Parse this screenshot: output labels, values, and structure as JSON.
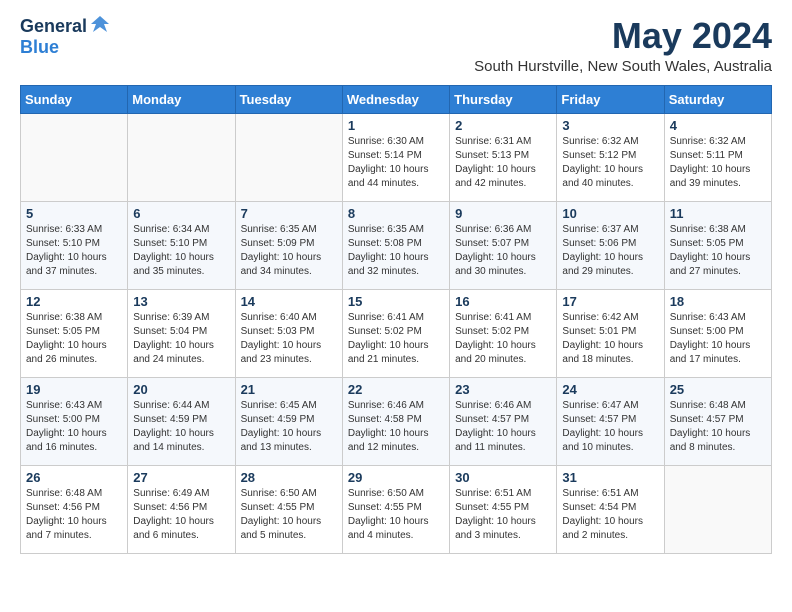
{
  "header": {
    "logo_general": "General",
    "logo_blue": "Blue",
    "title": "May 2024",
    "subtitle": "South Hurstville, New South Wales, Australia"
  },
  "weekdays": [
    "Sunday",
    "Monday",
    "Tuesday",
    "Wednesday",
    "Thursday",
    "Friday",
    "Saturday"
  ],
  "weeks": [
    [
      {
        "day": "",
        "info": ""
      },
      {
        "day": "",
        "info": ""
      },
      {
        "day": "",
        "info": ""
      },
      {
        "day": "1",
        "info": "Sunrise: 6:30 AM\nSunset: 5:14 PM\nDaylight: 10 hours\nand 44 minutes."
      },
      {
        "day": "2",
        "info": "Sunrise: 6:31 AM\nSunset: 5:13 PM\nDaylight: 10 hours\nand 42 minutes."
      },
      {
        "day": "3",
        "info": "Sunrise: 6:32 AM\nSunset: 5:12 PM\nDaylight: 10 hours\nand 40 minutes."
      },
      {
        "day": "4",
        "info": "Sunrise: 6:32 AM\nSunset: 5:11 PM\nDaylight: 10 hours\nand 39 minutes."
      }
    ],
    [
      {
        "day": "5",
        "info": "Sunrise: 6:33 AM\nSunset: 5:10 PM\nDaylight: 10 hours\nand 37 minutes."
      },
      {
        "day": "6",
        "info": "Sunrise: 6:34 AM\nSunset: 5:10 PM\nDaylight: 10 hours\nand 35 minutes."
      },
      {
        "day": "7",
        "info": "Sunrise: 6:35 AM\nSunset: 5:09 PM\nDaylight: 10 hours\nand 34 minutes."
      },
      {
        "day": "8",
        "info": "Sunrise: 6:35 AM\nSunset: 5:08 PM\nDaylight: 10 hours\nand 32 minutes."
      },
      {
        "day": "9",
        "info": "Sunrise: 6:36 AM\nSunset: 5:07 PM\nDaylight: 10 hours\nand 30 minutes."
      },
      {
        "day": "10",
        "info": "Sunrise: 6:37 AM\nSunset: 5:06 PM\nDaylight: 10 hours\nand 29 minutes."
      },
      {
        "day": "11",
        "info": "Sunrise: 6:38 AM\nSunset: 5:05 PM\nDaylight: 10 hours\nand 27 minutes."
      }
    ],
    [
      {
        "day": "12",
        "info": "Sunrise: 6:38 AM\nSunset: 5:05 PM\nDaylight: 10 hours\nand 26 minutes."
      },
      {
        "day": "13",
        "info": "Sunrise: 6:39 AM\nSunset: 5:04 PM\nDaylight: 10 hours\nand 24 minutes."
      },
      {
        "day": "14",
        "info": "Sunrise: 6:40 AM\nSunset: 5:03 PM\nDaylight: 10 hours\nand 23 minutes."
      },
      {
        "day": "15",
        "info": "Sunrise: 6:41 AM\nSunset: 5:02 PM\nDaylight: 10 hours\nand 21 minutes."
      },
      {
        "day": "16",
        "info": "Sunrise: 6:41 AM\nSunset: 5:02 PM\nDaylight: 10 hours\nand 20 minutes."
      },
      {
        "day": "17",
        "info": "Sunrise: 6:42 AM\nSunset: 5:01 PM\nDaylight: 10 hours\nand 18 minutes."
      },
      {
        "day": "18",
        "info": "Sunrise: 6:43 AM\nSunset: 5:00 PM\nDaylight: 10 hours\nand 17 minutes."
      }
    ],
    [
      {
        "day": "19",
        "info": "Sunrise: 6:43 AM\nSunset: 5:00 PM\nDaylight: 10 hours\nand 16 minutes."
      },
      {
        "day": "20",
        "info": "Sunrise: 6:44 AM\nSunset: 4:59 PM\nDaylight: 10 hours\nand 14 minutes."
      },
      {
        "day": "21",
        "info": "Sunrise: 6:45 AM\nSunset: 4:59 PM\nDaylight: 10 hours\nand 13 minutes."
      },
      {
        "day": "22",
        "info": "Sunrise: 6:46 AM\nSunset: 4:58 PM\nDaylight: 10 hours\nand 12 minutes."
      },
      {
        "day": "23",
        "info": "Sunrise: 6:46 AM\nSunset: 4:57 PM\nDaylight: 10 hours\nand 11 minutes."
      },
      {
        "day": "24",
        "info": "Sunrise: 6:47 AM\nSunset: 4:57 PM\nDaylight: 10 hours\nand 10 minutes."
      },
      {
        "day": "25",
        "info": "Sunrise: 6:48 AM\nSunset: 4:57 PM\nDaylight: 10 hours\nand 8 minutes."
      }
    ],
    [
      {
        "day": "26",
        "info": "Sunrise: 6:48 AM\nSunset: 4:56 PM\nDaylight: 10 hours\nand 7 minutes."
      },
      {
        "day": "27",
        "info": "Sunrise: 6:49 AM\nSunset: 4:56 PM\nDaylight: 10 hours\nand 6 minutes."
      },
      {
        "day": "28",
        "info": "Sunrise: 6:50 AM\nSunset: 4:55 PM\nDaylight: 10 hours\nand 5 minutes."
      },
      {
        "day": "29",
        "info": "Sunrise: 6:50 AM\nSunset: 4:55 PM\nDaylight: 10 hours\nand 4 minutes."
      },
      {
        "day": "30",
        "info": "Sunrise: 6:51 AM\nSunset: 4:55 PM\nDaylight: 10 hours\nand 3 minutes."
      },
      {
        "day": "31",
        "info": "Sunrise: 6:51 AM\nSunset: 4:54 PM\nDaylight: 10 hours\nand 2 minutes."
      },
      {
        "day": "",
        "info": ""
      }
    ]
  ]
}
